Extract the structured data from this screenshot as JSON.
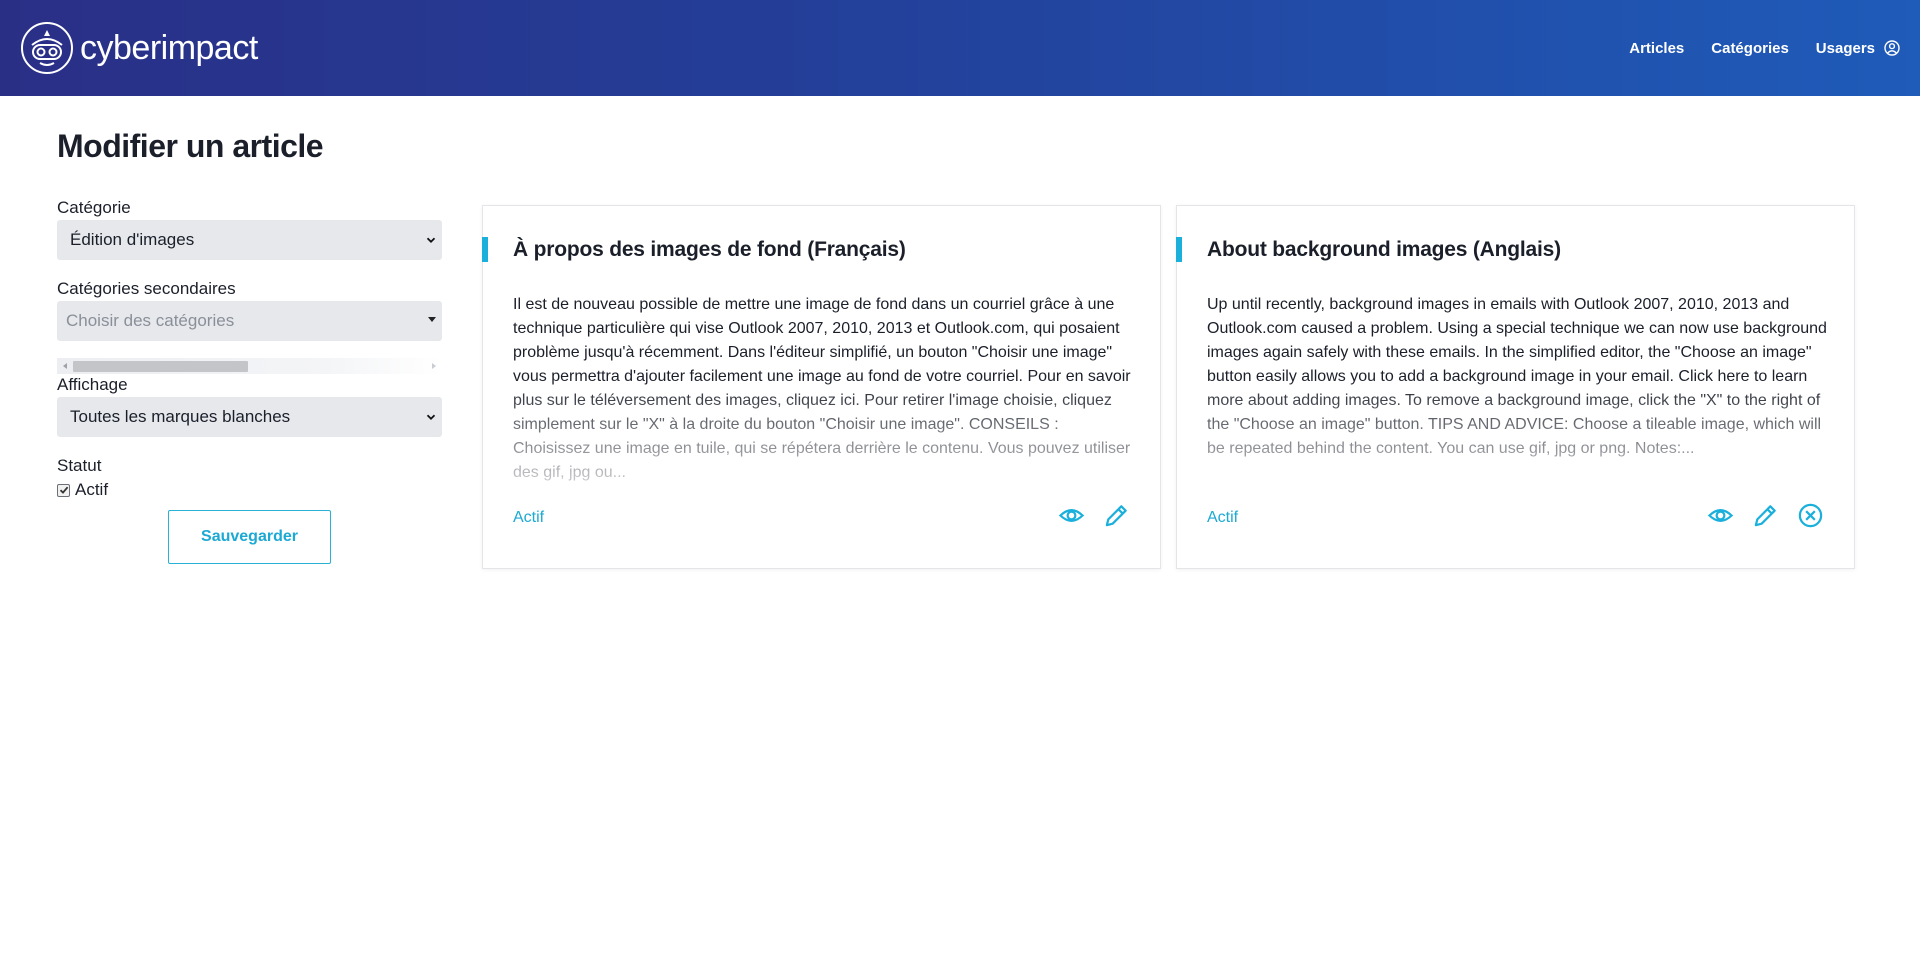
{
  "header": {
    "brand_name": "cyberimpact",
    "nav": {
      "articles": "Articles",
      "categories": "Catégories",
      "users": "Usagers"
    }
  },
  "page": {
    "title": "Modifier un article"
  },
  "form": {
    "category_label": "Catégorie",
    "category_value": "Édition d'images",
    "secondary_label": "Catégories secondaires",
    "secondary_placeholder": "Choisir des catégories",
    "display_label": "Affichage",
    "display_value": "Toutes les marques blanches",
    "status_label": "Statut",
    "status_checkbox_label": "Actif",
    "status_checked": true,
    "save_label": "Sauvegarder"
  },
  "cards": [
    {
      "title": "À propos des images de fond (Français)",
      "body": "Il est de nouveau possible de mettre une image de fond dans un courriel grâce à une technique particulière qui vise Outlook 2007, 2010, 2013 et Outlook.com, qui posaient problème jusqu'à récemment. Dans l'éditeur simplifié, un bouton \"Choisir une image\" vous permettra d'ajouter facilement une image au fond de votre courriel. Pour en savoir plus sur le téléversement des images, cliquez ici.   Pour retirer l'image choisie, cliquez simplement sur le \"X\" à la droite du bouton \"Choisir une image\". CONSEILS : Choisissez une image en tuile, qui se répétera derrière le contenu. Vous pouvez utiliser des gif, jpg ou...",
      "status": "Actif"
    },
    {
      "title": "About background images (Anglais)",
      "body": "Up until recently, background images in emails with Outlook 2007, 2010, 2013 and Outlook.com caused a problem. Using a special technique we can now use background images again safely with these emails. In the simplified editor, the \"Choose an image\" button easily allows you to add a background image in your email. Click here to learn more about adding images.   To remove a background image, click the \"X\" to the right of the \"Choose an image\" button. TIPS AND ADVICE: Choose a tileable image, which will be repeated behind the content. You can use gif, jpg or png. Notes:...",
      "status": "Actif"
    }
  ],
  "colors": {
    "header_start": "#2a2f86",
    "header_end": "#1f5bb9",
    "accent": "#1bb0db",
    "text": "#1b1f2a"
  },
  "icons": [
    "cyberimpact-logo",
    "user-circle-icon",
    "chevron-down-icon",
    "eye-icon",
    "pencil-icon",
    "close-circle-icon"
  ]
}
